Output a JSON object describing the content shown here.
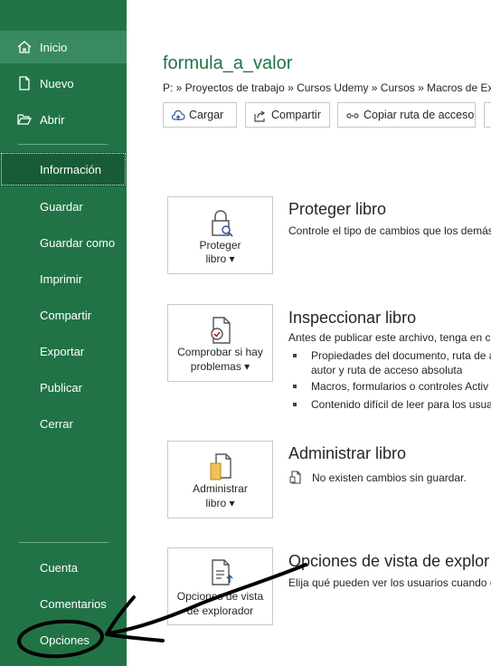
{
  "sidebar": {
    "items": [
      {
        "label": "Inicio",
        "icon": "home-icon"
      },
      {
        "label": "Nuevo",
        "icon": "new-document-icon"
      },
      {
        "label": "Abrir",
        "icon": "open-folder-icon"
      },
      {
        "label": "Información"
      },
      {
        "label": "Guardar"
      },
      {
        "label": "Guardar como"
      },
      {
        "label": "Imprimir"
      },
      {
        "label": "Compartir"
      },
      {
        "label": "Exportar"
      },
      {
        "label": "Publicar"
      },
      {
        "label": "Cerrar"
      },
      {
        "label": "Cuenta"
      },
      {
        "label": "Comentarios"
      },
      {
        "label": "Opciones"
      }
    ]
  },
  "document": {
    "title": "formula_a_valor",
    "breadcrumb": "P: » Proyectos de trabajo » Cursos Udemy » Cursos » Macros de Excel"
  },
  "toolbar": {
    "upload_label": "Cargar",
    "share_label": "Compartir",
    "copy_path_label": "Copiar ruta de acceso"
  },
  "sections": {
    "protect": {
      "button_line1": "Proteger",
      "button_line2": "libro ▾",
      "title": "Proteger libro",
      "desc": "Controle el tipo de cambios que los demás"
    },
    "inspect": {
      "button_line1": "Comprobar si hay",
      "button_line2": "problemas ▾",
      "title": "Inspeccionar libro",
      "desc": "Antes de publicar este archivo, tenga en cu",
      "bullets": [
        {
          "line1": "Propiedades del documento, ruta de a",
          "line2": "autor y ruta de acceso absoluta"
        },
        {
          "line1": "Macros, formularios o controles Activ"
        },
        {
          "line1": "Contenido difícil de leer para los usua"
        }
      ]
    },
    "manage": {
      "button_line1": "Administrar",
      "button_line2": "libro ▾",
      "title": "Administrar libro",
      "status": "No existen cambios sin guardar."
    },
    "browser": {
      "button_line1": "Opciones de vista",
      "button_line2": "de explorador",
      "title": "Opciones de vista de explor",
      "desc": "Elija qué pueden ver los usuarios cuando e"
    }
  },
  "colors": {
    "sidebar": "#217346",
    "accent_title": "#217346",
    "annotation_ink": "#000000"
  }
}
